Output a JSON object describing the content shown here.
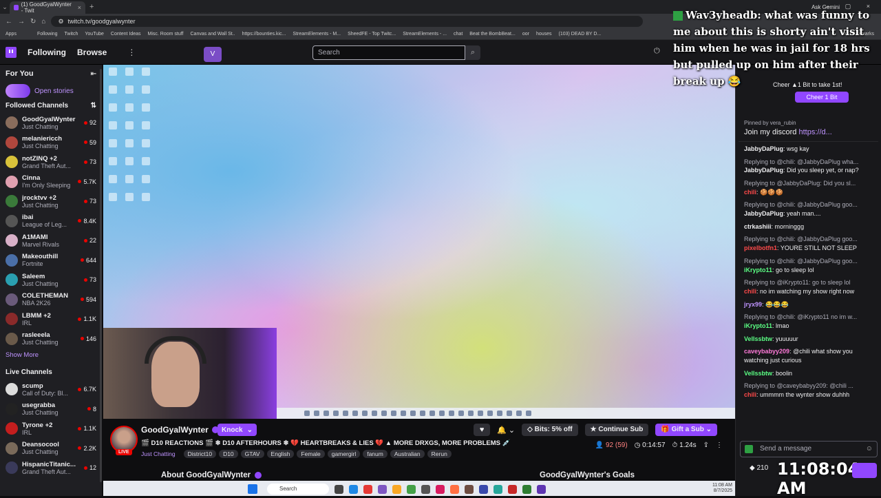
{
  "browser": {
    "tab_title": "(1) GoodGyalWynter - Twit",
    "url": "twitch.tv/goodgyalwynter",
    "ask_gemini": "Ask Gemini",
    "bookmarks": [
      "Apps",
      "",
      "",
      "Following",
      "Twitch",
      "YouTube",
      "Content Ideas",
      "Misc. Room stuff",
      "Canvas and Wall St..",
      "https://bounties.kic...",
      "StreamElements - M...",
      "SheedFE - Top Twitc...",
      "StreamElements - ...",
      "chat",
      "Beat the BombBeat...",
      "oor",
      "houses",
      "(103) DEAD BY D...",
      "All Bookmarks"
    ]
  },
  "topnav": {
    "following": "Following",
    "browse": "Browse",
    "search_placeholder": "Search",
    "vtuber_badge": "V"
  },
  "sidebar": {
    "for_you": "For You",
    "open_stories": "Open stories",
    "followed_title": "Followed Channels",
    "followed": [
      {
        "name": "GoodGyalWynter",
        "game": "Just Chatting",
        "viewers": "92",
        "color": "#8a6d5c"
      },
      {
        "name": "melaniericch",
        "game": "Just Chatting",
        "viewers": "59",
        "color": "#b0473d"
      },
      {
        "name": "notZINQ +2",
        "game": "Grand Theft Aut...",
        "viewers": "73",
        "color": "#d8c23a"
      },
      {
        "name": "Cinna",
        "game": "I'm Only Sleeping",
        "viewers": "5.7K",
        "color": "#e0a0b0"
      },
      {
        "name": "jrocktvv +2",
        "game": "Just Chatting",
        "viewers": "73",
        "color": "#3a7a3a"
      },
      {
        "name": "ibai",
        "game": "League of Leg...",
        "viewers": "8.4K",
        "color": "#555"
      },
      {
        "name": "A1MAMI",
        "game": "Marvel Rivals",
        "viewers": "22",
        "color": "#d8b0c8"
      },
      {
        "name": "Makeouthill",
        "game": "Fortnite",
        "viewers": "644",
        "color": "#4a6fa8"
      },
      {
        "name": "Saleem",
        "game": "Just Chatting",
        "viewers": "73",
        "color": "#2a9fb0"
      },
      {
        "name": "COLETHEMAN",
        "game": "NBA 2K26",
        "viewers": "594",
        "color": "#6a5a7a"
      },
      {
        "name": "LBMM +2",
        "game": "IRL",
        "viewers": "1.1K",
        "color": "#8a2a2a"
      },
      {
        "name": "rasleeela",
        "game": "Just Chatting",
        "viewers": "146",
        "color": "#6a5a4a"
      }
    ],
    "show_more": "Show More",
    "live_title": "Live Channels",
    "live": [
      {
        "name": "scump",
        "game": "Call of Duty: Bl...",
        "viewers": "6.7K",
        "color": "#dcdcdc"
      },
      {
        "name": "usegrabba",
        "game": "Just Chatting",
        "viewers": "8",
        "color": "#222"
      },
      {
        "name": "Tyrone +2",
        "game": "IRL",
        "viewers": "1.1K",
        "color": "#c41e1e"
      },
      {
        "name": "Deansocool",
        "game": "Just Chatting",
        "viewers": "2.2K",
        "color": "#7a6a5a"
      },
      {
        "name": "HispanicTitanic...",
        "game": "Grand Theft Aut...",
        "viewers": "12",
        "color": "#3a3a5a"
      }
    ]
  },
  "overlay_chat": {
    "user": "Wav3yheadb:",
    "message": "what was funny to me about this is shorty ain't visit him when he was in jail for 18 hrs but pulled up on him after their break up 😂"
  },
  "chat": {
    "cheer_note": "Cheer ▲1 Bit to take 1st!",
    "cheer_button": "Cheer 1 Bit",
    "pinned_by": "Pinned by vera_rubin",
    "pinned_text": "Join my discord",
    "pinned_link": "https://d...",
    "messages": [
      {
        "reply": "",
        "user": "JabbyDaPlug",
        "cls": "u-white",
        "text": "wsg kay"
      },
      {
        "reply": "Replying to @chili: @JabbyDaPlug wha...",
        "user": "JabbyDaPlug",
        "cls": "u-white",
        "text": "Did you sleep yet, or nap?"
      },
      {
        "reply": "Replying to @JabbyDaPlug: Did you sl...",
        "user": "chili",
        "cls": "u-red",
        "text": "🍪🍪🍪"
      },
      {
        "reply": "Replying to @chili: @JabbyDaPlug goo...",
        "user": "JabbyDaPlug",
        "cls": "u-white",
        "text": "yeah man...."
      },
      {
        "reply": "",
        "user": "ctrkashiii",
        "cls": "u-white",
        "text": "morninggg"
      },
      {
        "reply": "Replying to @chili: @JabbyDaPlug goo...",
        "user": "pixelbotfn1",
        "cls": "u-red",
        "text": "YOURE STILL NOT SLEEP"
      },
      {
        "reply": "Replying to @chili: @JabbyDaPlug goo...",
        "user": "iKrypto11",
        "cls": "u-green",
        "text": "go to sleep lol"
      },
      {
        "reply": "Replying to @iKrypto11: go to sleep lol",
        "user": "chili",
        "cls": "u-red",
        "text": "no im watching my show right now"
      },
      {
        "reply": "",
        "user": "jryx99",
        "cls": "u-purple",
        "text": "😂😂😂"
      },
      {
        "reply": "Replying to @chili: @iKrypto11 no im w...",
        "user": "iKrypto11",
        "cls": "u-green",
        "text": "lmao"
      },
      {
        "reply": "",
        "user": "Vellssbtw",
        "cls": "u-green",
        "text": "yuuuuur"
      },
      {
        "reply": "",
        "user": "caveybabyy209",
        "cls": "u-pink",
        "text": "@chili what show you watching just curious"
      },
      {
        "reply": "",
        "user": "Vellssbtw",
        "cls": "u-green",
        "text": "boolin"
      },
      {
        "reply": "Replying to @caveybabyy209: @chili ...",
        "user": "chili",
        "cls": "u-red",
        "text": "ummmm the wynter show duhhh"
      }
    ],
    "input_placeholder": "Send a message",
    "points": "210",
    "clock": "11:08:04 AM"
  },
  "stream": {
    "live": "LIVE",
    "streamer": "GoodGyalWynter",
    "knock": "Knock",
    "title": "🎬 D10 REACTIONS 🎬 ❄ D10 AFTERHOURS ❄ 💔 HEARTBREAKS & LIES 💔 ▲ MORE DRXGS, MORE PROBLEMS 💉",
    "category": "Just Chatting",
    "tags": [
      "District10",
      "D10",
      "GTAV",
      "English",
      "Female",
      "gamergirl",
      "fanum",
      "Australian",
      "Rerun"
    ],
    "bits_offer": "Bits: 5% off",
    "continue_sub": "Continue Sub",
    "gift_sub": "Gift a Sub",
    "viewers": "92 (59)",
    "uptime": "0:14:57",
    "latency": "1.24s",
    "about": "About GoodGyalWynter",
    "goals": "GoodGyalWynter's Goals"
  },
  "taskbar": {
    "search": "Search",
    "time": "11:08 AM",
    "date": "8/7/2025"
  }
}
